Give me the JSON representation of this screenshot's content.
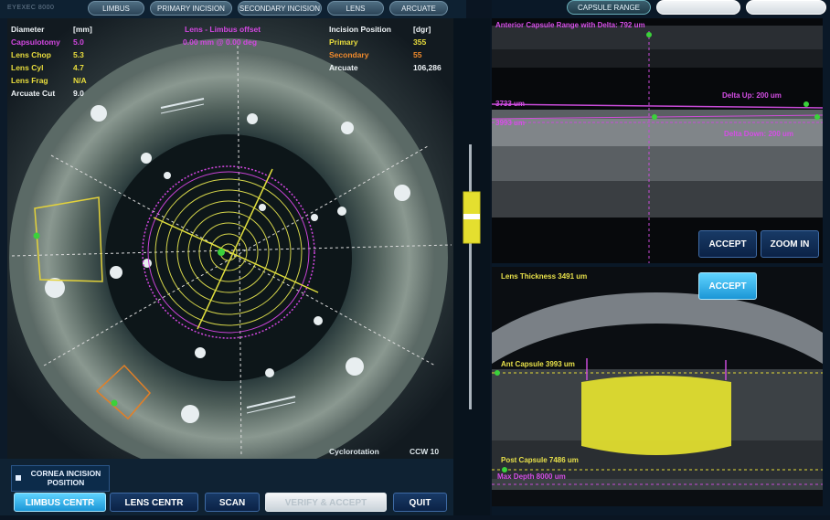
{
  "brand": "EYEXEC 8000",
  "tabs": [
    "LIMBUS",
    "PRIMARY INCISION",
    "SECONDARY INCISION",
    "LENS",
    "ARCUATE"
  ],
  "right_tabs": {
    "capsule_range": "CAPSULE RANGE"
  },
  "info": {
    "diameter_label": "Diameter",
    "diameter_unit": "[mm]",
    "rows": [
      {
        "label": "Capsulotomy",
        "value": "5.0",
        "color": "magenta"
      },
      {
        "label": "Lens Chop",
        "value": "5.3",
        "color": "yellow"
      },
      {
        "label": "Lens Cyl",
        "value": "4.7",
        "color": "yellow"
      },
      {
        "label": "Lens Frag",
        "value": "N/A",
        "color": "yellow"
      },
      {
        "label": "Arcuate Cut",
        "value": "9.0",
        "color": "white"
      }
    ],
    "lens_offset_line1": "Lens - Limbus offset",
    "lens_offset_line2": "0.00 mm @ 0.00 deg",
    "incision_label": "Incision Position",
    "incision_unit": "[dgr]",
    "incisions": [
      {
        "label": "Primary",
        "value": "355",
        "color": "yellow"
      },
      {
        "label": "Secondary",
        "value": "55",
        "color": "orange"
      },
      {
        "label": "Arcuate",
        "value": "106,286",
        "color": "white"
      }
    ],
    "cyclorotation_label": "Cyclorotation",
    "cyclorotation_value": "CCW 10"
  },
  "bottom": {
    "cornea_incision_label": "CORNEA INCISION POSITION",
    "limbus_centr": "LIMBUS CENTR",
    "lens_centr": "LENS CENTR",
    "scan": "SCAN",
    "verify_accept": "VERIFY & ACCEPT",
    "quit": "QUIT"
  },
  "oct_top": {
    "anterior_capsule_range": "Anterior Capsule Range with Delta: 792 um",
    "delta_up": "Delta Up: 200 um",
    "label_a": "3733 um",
    "label_b": "3993 um",
    "delta_down": "Delta Down: 200 um",
    "accept": "ACCEPT",
    "zoom_in": "ZOOM IN"
  },
  "oct_bottom": {
    "lens_thickness": "Lens Thickness 3491 um",
    "accept": "ACCEPT",
    "ant_capsule": "Ant Capsule 3993 um",
    "post_capsule": "Post Capsule 7486 um",
    "max_depth": "Max Depth 8000 um"
  },
  "colors": {
    "magenta": "#d347e1",
    "yellow": "#e9dd3d",
    "orange": "#f08a2c",
    "green": "#3bd13b",
    "cyan_button": "#32b6ef"
  }
}
